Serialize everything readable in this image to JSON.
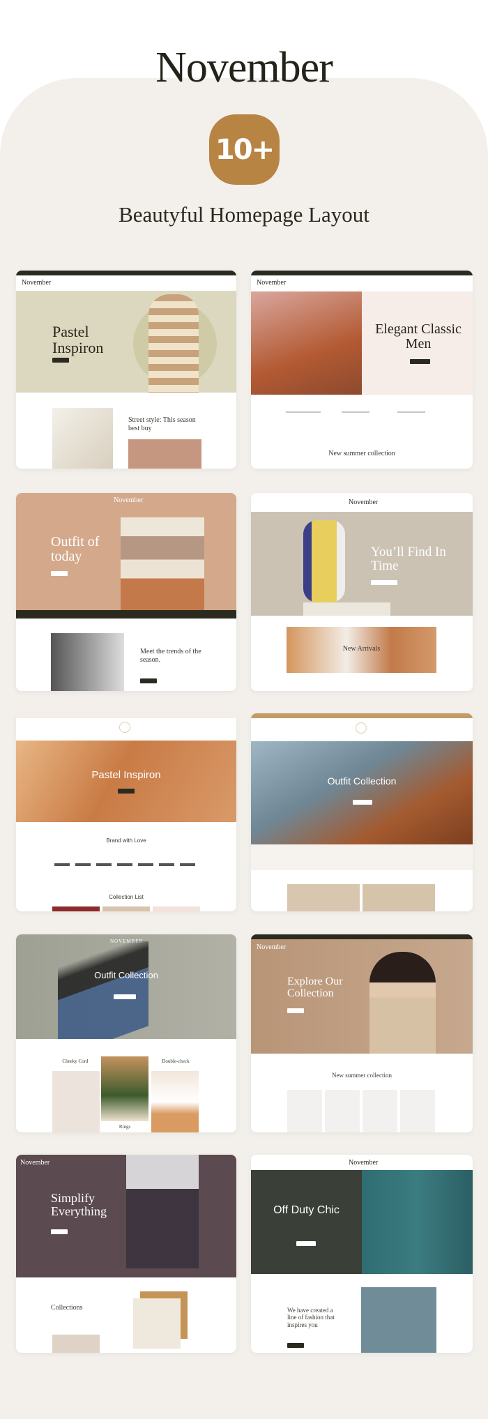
{
  "header": {
    "brand": "November",
    "badge": "10+",
    "subtitle": "Beautyful Homepage Layout"
  },
  "colors": {
    "accent": "#b88443",
    "panel": "#f3f0eb",
    "dark": "#2b2a1f"
  },
  "layouts": [
    {
      "logo": "November",
      "title": "Pastel Inspiron",
      "lower_title": "Street style: This season best buy"
    },
    {
      "logo": "November",
      "title": "Elegant Classic Men",
      "lower_title": "New summer collection"
    },
    {
      "logo": "November",
      "title": "Outfit of today",
      "lower_title": "Meet the trends of the season."
    },
    {
      "logo": "November",
      "title": "You’ll Find In Time",
      "lower_title": "New Arrivals"
    },
    {
      "title": "Pastel Inspiron",
      "lower_title": "Brand with Love",
      "lower_title2": "Collection List"
    },
    {
      "title": "Outfit Collection"
    },
    {
      "logo": "NOVEMBER",
      "title": "Outfit Collection",
      "items": [
        "Cheeky Cord",
        "Double-check",
        "Rings"
      ]
    },
    {
      "logo": "November",
      "title": "Explore Our Collection",
      "lower_title": "New summer collection"
    },
    {
      "logo": "November",
      "title": "Simplify Everything",
      "lower_title": "Collections"
    },
    {
      "logo": "November",
      "title": "Off Duty Chic",
      "lower_title": "We have created a line of fashion that inspires you"
    }
  ]
}
